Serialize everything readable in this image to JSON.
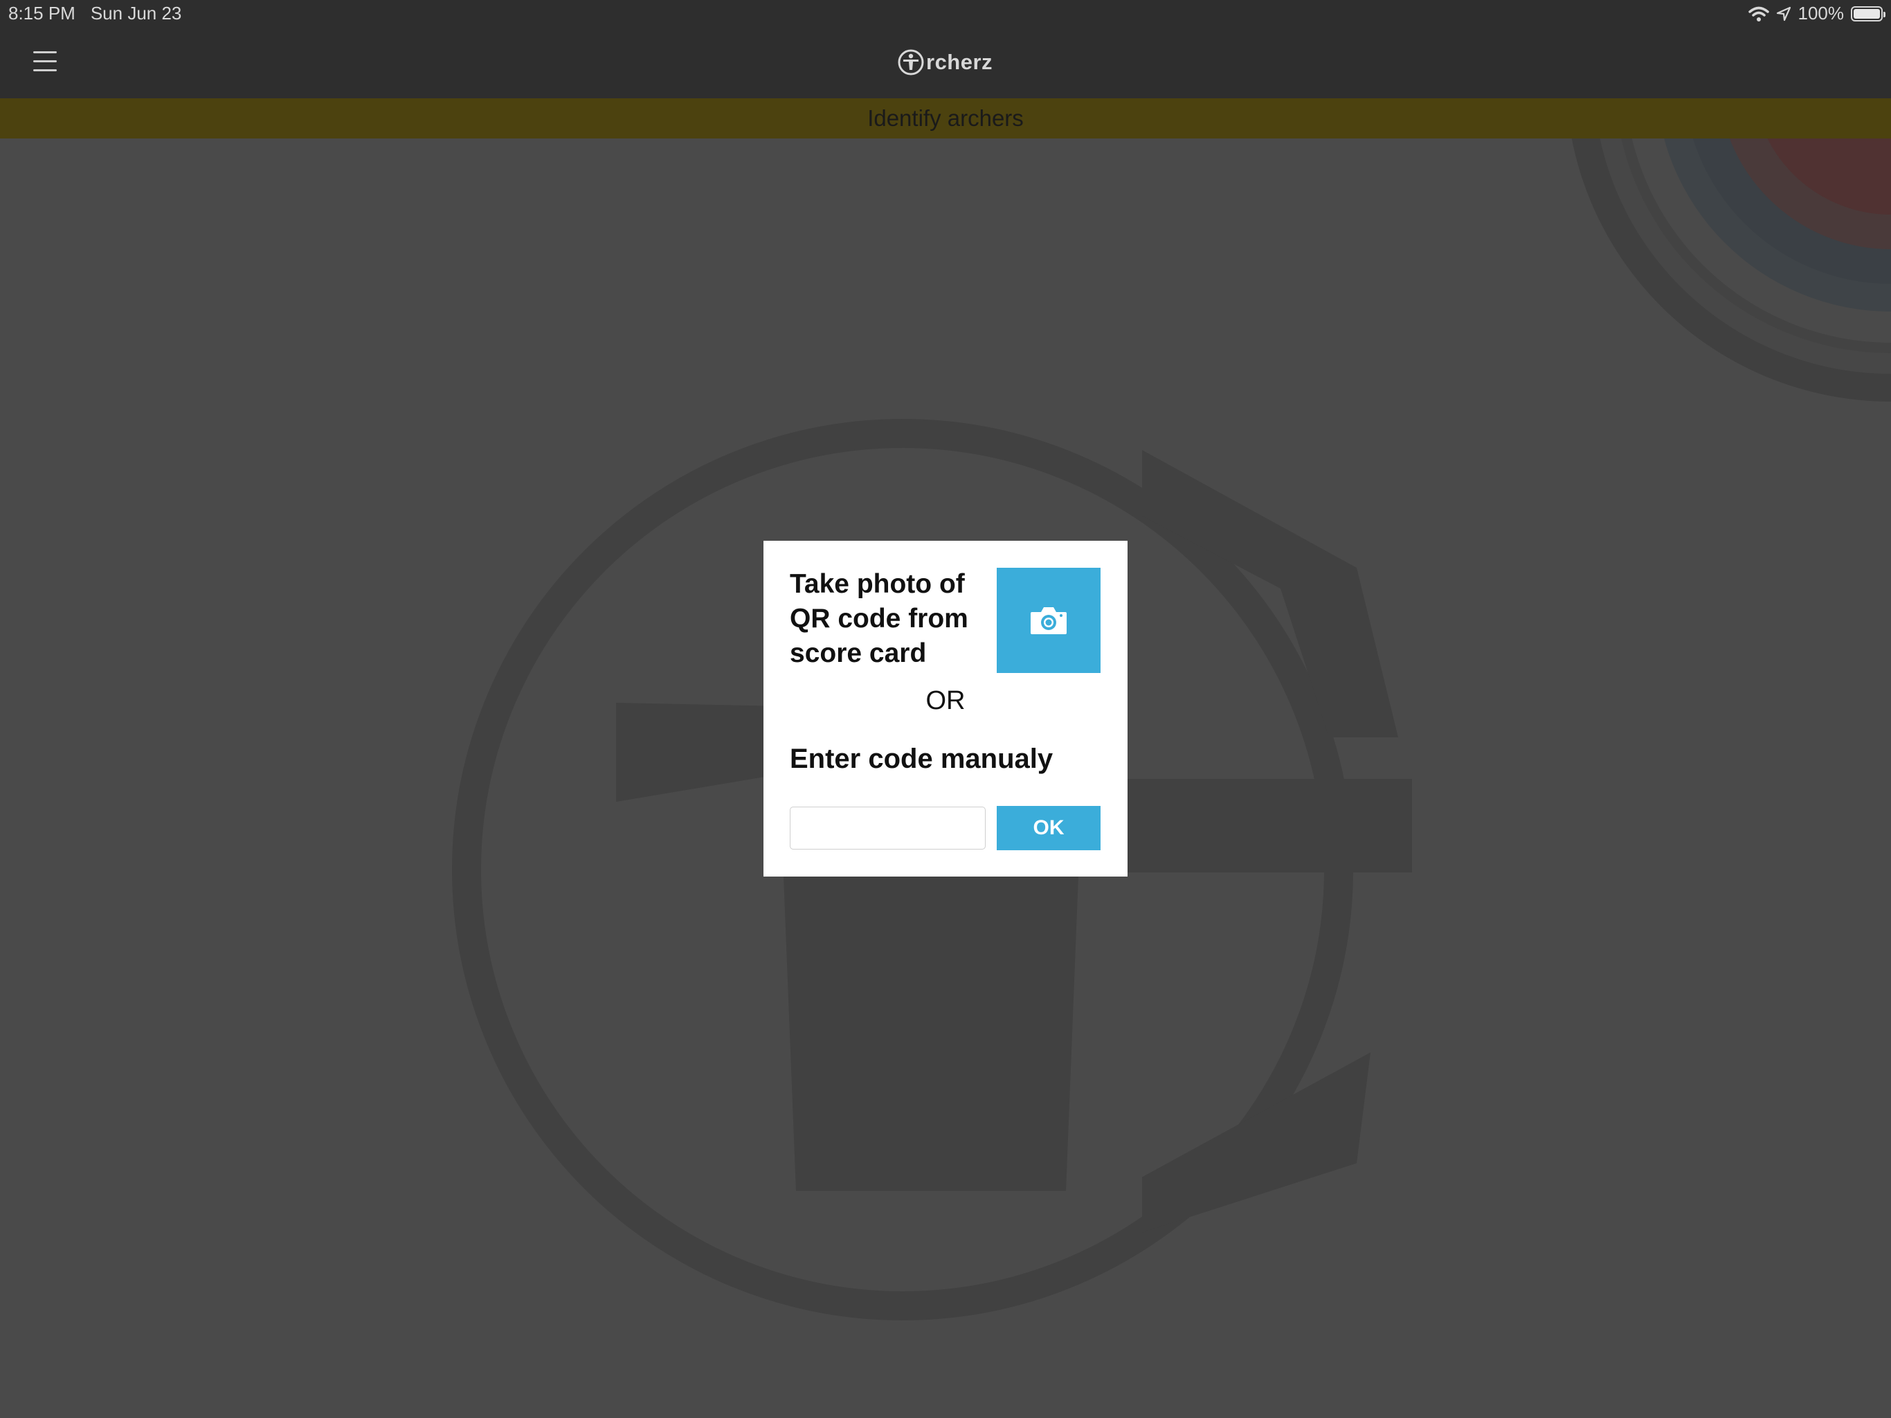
{
  "status_bar": {
    "time": "8:15 PM",
    "date": "Sun Jun 23",
    "battery": "100%",
    "battery_level": 1.0,
    "icons": [
      "wifi-icon",
      "location-arrow-icon",
      "battery-icon"
    ]
  },
  "nav": {
    "logo_text": "rcherz",
    "menu_icon": "hamburger-menu-icon"
  },
  "banner": {
    "title": "Identify archers"
  },
  "dialog": {
    "photo_prompt": "Take photo of QR code from score card",
    "camera_icon": "camera-icon",
    "or_label": "OR",
    "manual_heading": "Enter code manualy",
    "code_value": "",
    "code_placeholder": "",
    "ok_label": "OK"
  },
  "colors": {
    "accent": "#3badda",
    "nav_background": "#2e2e2e",
    "banner_background": "#4c420f",
    "overlay_background": "#4a4a4a",
    "dialog_background": "#ffffff"
  }
}
